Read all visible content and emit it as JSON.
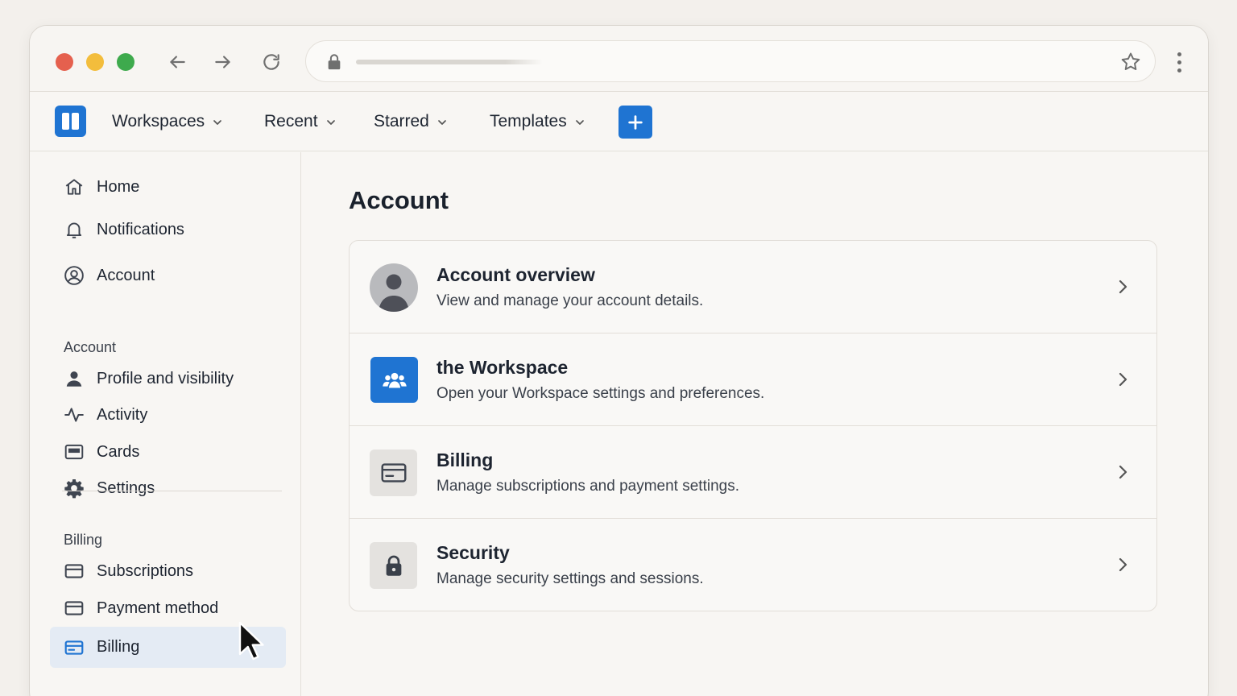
{
  "browser": {
    "icons": [
      "close-dot",
      "minimize-dot",
      "maximize-dot",
      "back-arrow-icon",
      "forward-arrow-icon",
      "reload-icon",
      "lock-icon",
      "star-icon",
      "kebab-menu-icon"
    ]
  },
  "header": {
    "menus": [
      {
        "label": "Workspaces"
      },
      {
        "label": "Recent"
      },
      {
        "label": "Starred"
      },
      {
        "label": "Templates"
      }
    ],
    "create_icon": "plus-icon",
    "accent": "#1f74d2"
  },
  "sidebar": {
    "top_items": [
      {
        "label": "Home",
        "icon": "home-icon"
      },
      {
        "label": "Notifications",
        "icon": "bell-icon"
      },
      {
        "label": "Account",
        "icon": "user-circle-icon"
      }
    ],
    "account_section": {
      "heading": "Account",
      "items": [
        {
          "label": "Profile and visibility",
          "icon": "person-icon"
        },
        {
          "label": "Activity",
          "icon": "activity-icon"
        },
        {
          "label": "Cards",
          "icon": "card-icon"
        },
        {
          "label": "Settings",
          "icon": "gear-icon"
        }
      ]
    },
    "billing_section": {
      "heading": "Billing",
      "items": [
        {
          "label": "Subscriptions",
          "icon": "credit-card-icon"
        },
        {
          "label": "Payment method",
          "icon": "credit-card-icon"
        },
        {
          "label": "Billing",
          "icon": "credit-card-icon",
          "active": true
        }
      ]
    },
    "active_bg": "#e4ebf4"
  },
  "main": {
    "title": "Account",
    "rows": [
      {
        "title": "Account overview",
        "description": "View and manage your account details.",
        "icon": "avatar-icon"
      },
      {
        "title": "the Workspace",
        "description": "Open your Workspace settings and preferences.",
        "icon": "team-icon"
      },
      {
        "title": "Billing",
        "description": "Manage subscriptions and payment settings.",
        "icon": "credit-card-icon"
      },
      {
        "title": "Security",
        "description": "Manage security settings and sessions.",
        "icon": "lock-icon"
      }
    ]
  }
}
